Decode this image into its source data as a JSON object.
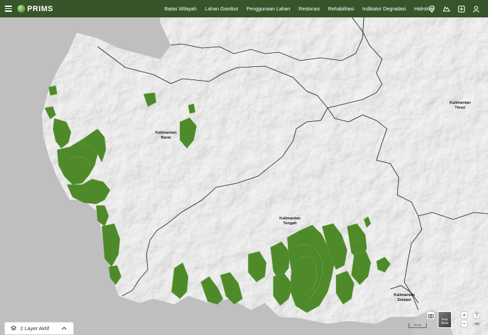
{
  "app": {
    "name": "PRIMS"
  },
  "nav": {
    "items": [
      "Batas Wilayah",
      "Lahan Gambut",
      "Penggunaan Lahan",
      "Restorasi",
      "Rehabilitasi",
      "Indikator Degradasi",
      "Hidrologi"
    ],
    "icons": [
      "location-pin-icon",
      "layers-icon",
      "add-icon",
      "user-icon"
    ]
  },
  "map": {
    "region_labels": [
      {
        "text": "Kalimantan\nBarat"
      },
      {
        "text": "Kalimantan\nTengah"
      },
      {
        "text": "Kalimantan\nTimur"
      },
      {
        "text": "Kalimantan\nSelatan"
      }
    ],
    "colors": {
      "land": "#e9e9e9",
      "sea": "#bfbfbf",
      "peat": "#4f8a2a",
      "boundary": "#1a1a1a",
      "topbar": "#37542b"
    }
  },
  "layers_button": {
    "label": "2 Layer Aktif"
  },
  "controls": {
    "zoom_in": "+",
    "zoom_out": "−",
    "help": "?",
    "basemap_label": "Peta dasar",
    "scale_label": "50 km"
  }
}
